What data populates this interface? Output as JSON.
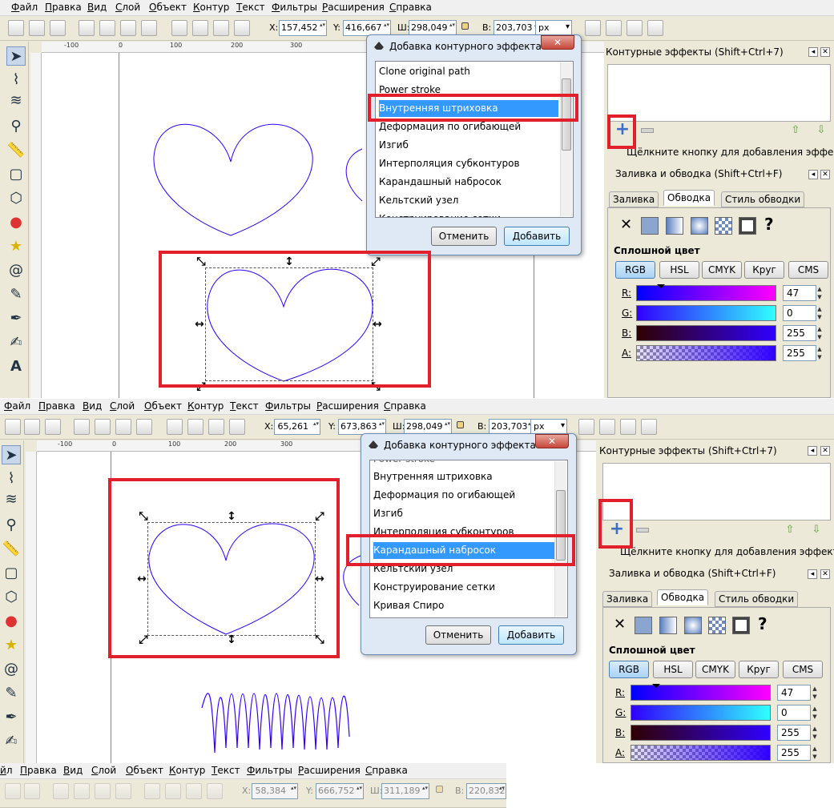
{
  "menu": [
    "Файл",
    "Правка",
    "Вид",
    "Слой",
    "Объект",
    "Контур",
    "Текст",
    "Фильтры",
    "Расширения",
    "Справка"
  ],
  "menu_truncated_first": "йл",
  "units": "px",
  "shot1": {
    "x_label": "X:",
    "x": "157,452",
    "y_label": "Y:",
    "y": "416,667",
    "w_label": "Ш:",
    "w": "298,049",
    "h_label": "В:",
    "h": "203,703",
    "ruler_ticks": [
      "-100",
      "0",
      "100",
      "200",
      "300"
    ],
    "dialog": {
      "title": "Добавка контурного эффекта",
      "items": [
        "Clone original path",
        "Power stroke",
        "Внутренняя штриховка",
        "Деформация по огибающей",
        "Изгиб",
        "Интерполяция субконтуров",
        "Карандашный набросок",
        "Кельтский узел",
        "Конструирование сетки"
      ],
      "selected_index": 2,
      "cancel": "Отменить",
      "add": "Добавить",
      "close": "✕"
    }
  },
  "shot2": {
    "x_label": "X:",
    "x": "65,261",
    "y_label": "Y:",
    "y": "673,863",
    "w_label": "Ш:",
    "w": "298,049",
    "h_label": "В:",
    "h": "203,703",
    "ruler_ticks": [
      "-100",
      "0",
      "100",
      "200",
      "300"
    ],
    "dialog": {
      "title": "Добавка контурного эффекта",
      "items": [
        "Power stroke",
        "Внутренняя штриховка",
        "Деформация по огибающей",
        "Изгиб",
        "Интерполяция субконтуров",
        "Карандашный набросок",
        "Кельтский узел",
        "Конструирование сетки",
        "Кривая Спиро"
      ],
      "selected_index": 5,
      "cancel": "Отменить",
      "add": "Добавить",
      "close": "✕"
    }
  },
  "shot3": {
    "x_label": "X:",
    "x": "58,384",
    "y_label": "Y:",
    "y": "666,752",
    "w_label": "Ш:",
    "w": "311,189",
    "h_label": "В:",
    "h": "220,832"
  },
  "panel": {
    "lpe_title": "Контурные эффекты (Shift+Ctrl+7)",
    "lpe_hint": "Щёлкните кнопку для добавления эффекта",
    "fill_title": "Заливка и обводка (Shift+Ctrl+F)",
    "tab_fill": "Заливка",
    "tab_stroke": "Обводка",
    "tab_stroke_style": "Стиль обводки",
    "x_mark": "✕",
    "question": "?",
    "solid_color": "Сплошной цвет",
    "modes": [
      "RGB",
      "HSL",
      "CMYK",
      "Круг",
      "CMS"
    ],
    "active_mode": "RGB",
    "channels": [
      {
        "label": "R:",
        "value": "47"
      },
      {
        "label": "G:",
        "value": "0"
      },
      {
        "label": "B:",
        "value": "255"
      },
      {
        "label": "A:",
        "value": "255"
      }
    ]
  },
  "colors": {
    "highlight": "#e1202c",
    "path_stroke": "#2f00ff",
    "selection": "#3399ff"
  },
  "icons": {
    "tools": [
      "selector-icon",
      "node-icon",
      "tweak-icon",
      "zoom-icon",
      "measure-icon",
      "rect-icon",
      "box3d-icon",
      "ellipse-icon",
      "star-icon",
      "spiral-icon",
      "pencil-icon",
      "pen-icon",
      "calligraphy-icon",
      "text-icon"
    ]
  }
}
